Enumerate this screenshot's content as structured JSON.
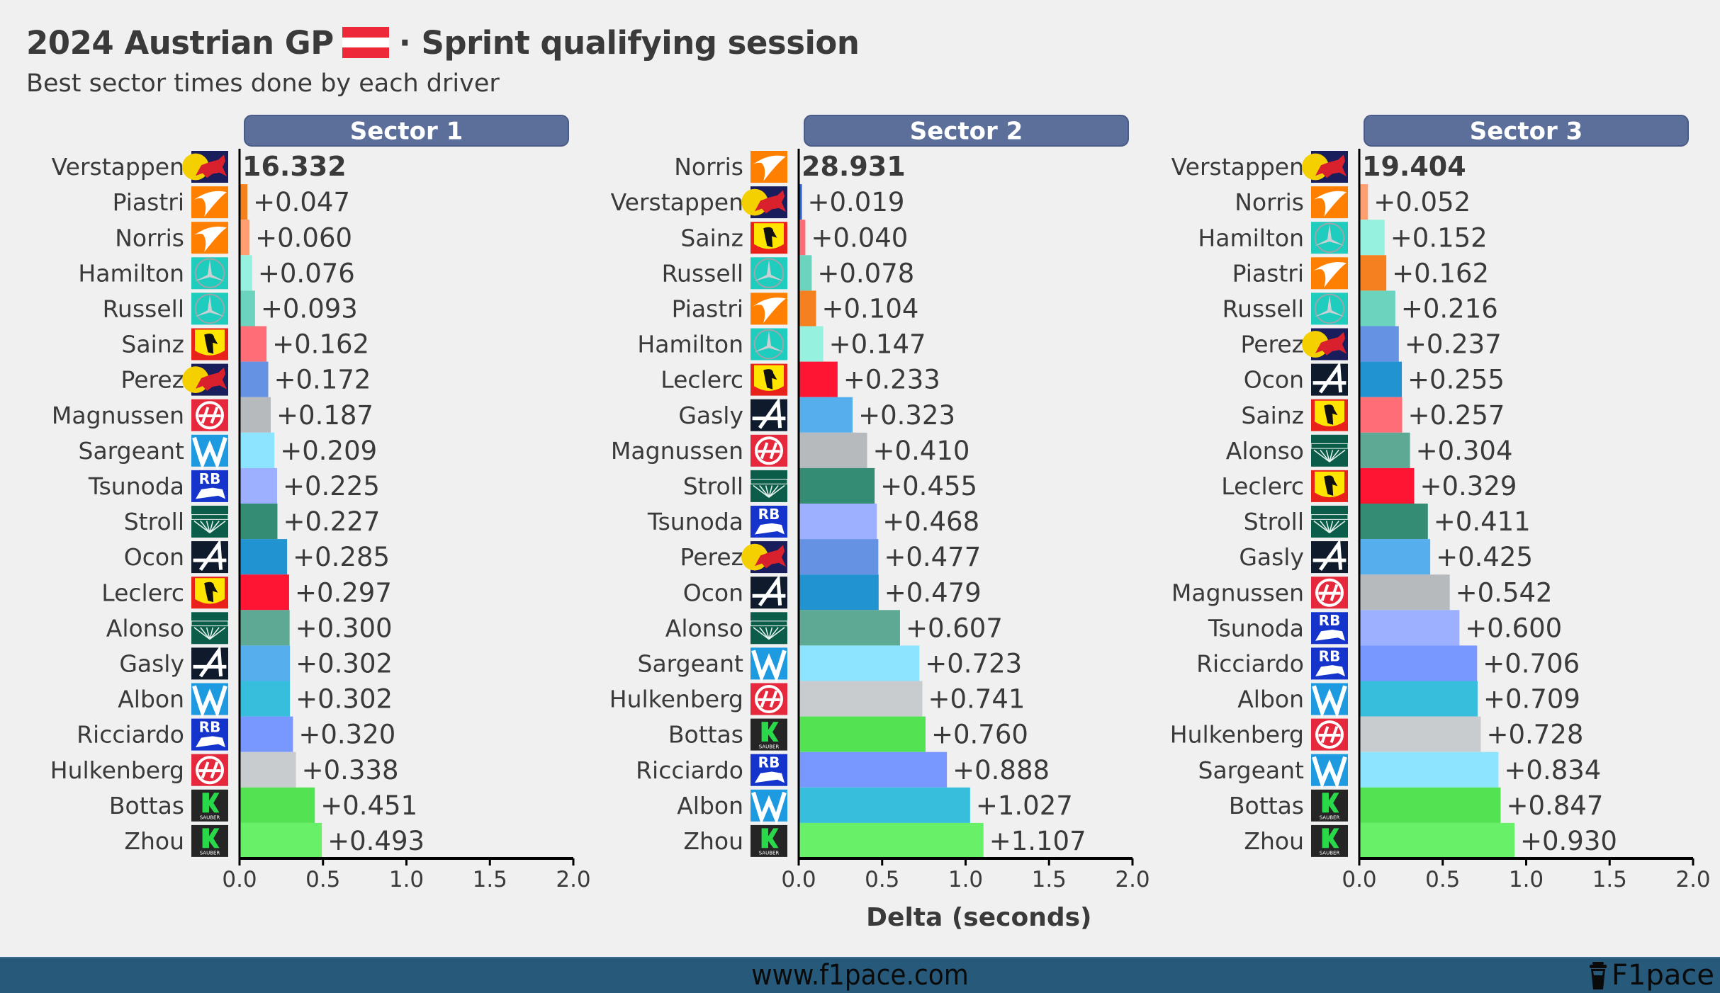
{
  "title": {
    "prefix": "2024 Austrian GP",
    "suffix": "· Sprint qualifying session",
    "flag_colors": [
      "#ed2939",
      "#ffffff",
      "#ed2939"
    ]
  },
  "subtitle": "Best sector times done by each driver",
  "footer": {
    "url": "www.f1pace.com",
    "brand": "F1pace",
    "brand_icon": "coffee-cup-icon"
  },
  "colors": {
    "background": "#f0f0f0",
    "header_box": "#5b6f9a",
    "text": "#3a3a3a",
    "footer": "#275a7a"
  },
  "teams": {
    "redbull": {
      "name": "Red Bull",
      "icon": "red-bull-logo-icon"
    },
    "mclaren": {
      "name": "McLaren",
      "icon": "mclaren-logo-icon"
    },
    "mercedes": {
      "name": "Mercedes",
      "icon": "mercedes-logo-icon"
    },
    "ferrari": {
      "name": "Ferrari",
      "icon": "ferrari-logo-icon"
    },
    "haas": {
      "name": "Haas",
      "icon": "haas-logo-icon"
    },
    "williams": {
      "name": "Williams",
      "icon": "williams-logo-icon"
    },
    "rb": {
      "name": "RB",
      "icon": "rb-logo-icon"
    },
    "aston": {
      "name": "Aston Martin",
      "icon": "aston-martin-logo-icon"
    },
    "alpine": {
      "name": "Alpine",
      "icon": "alpine-logo-icon"
    },
    "sauber": {
      "name": "Kick Sauber",
      "icon": "kick-sauber-logo-icon"
    }
  },
  "drivers": {
    "Verstappen": {
      "team": "redbull",
      "color": "#2b5fd0"
    },
    "Perez": {
      "team": "redbull",
      "color": "#6692e3"
    },
    "Piastri": {
      "team": "mclaren",
      "color": "#f58020"
    },
    "Norris": {
      "team": "mclaren",
      "color": "#ff9e6e"
    },
    "Hamilton": {
      "team": "mercedes",
      "color": "#96f2df"
    },
    "Russell": {
      "team": "mercedes",
      "color": "#6cd3bf"
    },
    "Sainz": {
      "team": "ferrari",
      "color": "#ff6e76"
    },
    "Leclerc": {
      "team": "ferrari",
      "color": "#ff1534"
    },
    "Magnussen": {
      "team": "haas",
      "color": "#b6babd"
    },
    "Hulkenberg": {
      "team": "haas",
      "color": "#c8ccce"
    },
    "Sargeant": {
      "team": "williams",
      "color": "#8ce4ff"
    },
    "Albon": {
      "team": "williams",
      "color": "#37bedd"
    },
    "Tsunoda": {
      "team": "rb",
      "color": "#9cb0ff"
    },
    "Ricciardo": {
      "team": "rb",
      "color": "#7898ff"
    },
    "Stroll": {
      "team": "aston",
      "color": "#358c75"
    },
    "Alonso": {
      "team": "aston",
      "color": "#5da993"
    },
    "Ocon": {
      "team": "alpine",
      "color": "#2293d1"
    },
    "Gasly": {
      "team": "alpine",
      "color": "#56aeec"
    },
    "Bottas": {
      "team": "sauber",
      "color": "#52e252"
    },
    "Zhou": {
      "team": "sauber",
      "color": "#69f069"
    }
  },
  "chart_data": [
    {
      "type": "bar",
      "orientation": "horizontal",
      "title": "Sector 1",
      "xlabel": "",
      "xlim": [
        0,
        2.0
      ],
      "xticks": [
        "0.0",
        "0.5",
        "1.0",
        "1.5",
        "2.0"
      ],
      "grid": false,
      "best_time": "16.332",
      "categories": [
        "Verstappen",
        "Piastri",
        "Norris",
        "Hamilton",
        "Russell",
        "Sainz",
        "Perez",
        "Magnussen",
        "Sargeant",
        "Tsunoda",
        "Stroll",
        "Ocon",
        "Leclerc",
        "Alonso",
        "Gasly",
        "Albon",
        "Ricciardo",
        "Hulkenberg",
        "Bottas",
        "Zhou"
      ],
      "values": [
        0.0,
        0.047,
        0.06,
        0.076,
        0.093,
        0.162,
        0.172,
        0.187,
        0.209,
        0.225,
        0.227,
        0.285,
        0.297,
        0.3,
        0.302,
        0.302,
        0.32,
        0.338,
        0.451,
        0.493
      ],
      "labels": [
        "16.332",
        "+0.047",
        "+0.060",
        "+0.076",
        "+0.093",
        "+0.162",
        "+0.172",
        "+0.187",
        "+0.209",
        "+0.225",
        "+0.227",
        "+0.285",
        "+0.297",
        "+0.300",
        "+0.302",
        "+0.302",
        "+0.320",
        "+0.338",
        "+0.451",
        "+0.493"
      ]
    },
    {
      "type": "bar",
      "orientation": "horizontal",
      "title": "Sector 2",
      "xlabel": "Delta (seconds)",
      "xlim": [
        0,
        2.0
      ],
      "xticks": [
        "0.0",
        "0.5",
        "1.0",
        "1.5",
        "2.0"
      ],
      "grid": false,
      "best_time": "28.931",
      "categories": [
        "Norris",
        "Verstappen",
        "Sainz",
        "Russell",
        "Piastri",
        "Hamilton",
        "Leclerc",
        "Gasly",
        "Magnussen",
        "Stroll",
        "Tsunoda",
        "Perez",
        "Ocon",
        "Alonso",
        "Sargeant",
        "Hulkenberg",
        "Bottas",
        "Ricciardo",
        "Albon",
        "Zhou"
      ],
      "values": [
        0.0,
        0.019,
        0.04,
        0.078,
        0.104,
        0.147,
        0.233,
        0.323,
        0.41,
        0.455,
        0.468,
        0.477,
        0.479,
        0.607,
        0.723,
        0.741,
        0.76,
        0.888,
        1.027,
        1.107
      ],
      "labels": [
        "28.931",
        "+0.019",
        "+0.040",
        "+0.078",
        "+0.104",
        "+0.147",
        "+0.233",
        "+0.323",
        "+0.410",
        "+0.455",
        "+0.468",
        "+0.477",
        "+0.479",
        "+0.607",
        "+0.723",
        "+0.741",
        "+0.760",
        "+0.888",
        "+1.027",
        "+1.107"
      ]
    },
    {
      "type": "bar",
      "orientation": "horizontal",
      "title": "Sector 3",
      "xlabel": "",
      "xlim": [
        0,
        2.0
      ],
      "xticks": [
        "0.0",
        "0.5",
        "1.0",
        "1.5",
        "2.0"
      ],
      "grid": false,
      "best_time": "19.404",
      "categories": [
        "Verstappen",
        "Norris",
        "Hamilton",
        "Piastri",
        "Russell",
        "Perez",
        "Ocon",
        "Sainz",
        "Alonso",
        "Leclerc",
        "Stroll",
        "Gasly",
        "Magnussen",
        "Tsunoda",
        "Ricciardo",
        "Albon",
        "Hulkenberg",
        "Sargeant",
        "Bottas",
        "Zhou"
      ],
      "values": [
        0.0,
        0.052,
        0.152,
        0.162,
        0.216,
        0.237,
        0.255,
        0.257,
        0.304,
        0.329,
        0.411,
        0.425,
        0.542,
        0.6,
        0.706,
        0.709,
        0.728,
        0.834,
        0.847,
        0.93
      ],
      "labels": [
        "19.404",
        "+0.052",
        "+0.152",
        "+0.162",
        "+0.216",
        "+0.237",
        "+0.255",
        "+0.257",
        "+0.304",
        "+0.329",
        "+0.411",
        "+0.425",
        "+0.542",
        "+0.600",
        "+0.706",
        "+0.709",
        "+0.728",
        "+0.834",
        "+0.847",
        "+0.930"
      ]
    }
  ]
}
